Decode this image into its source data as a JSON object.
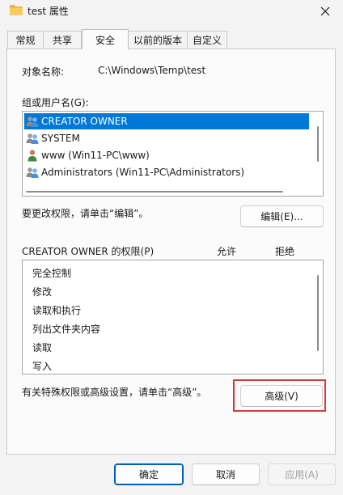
{
  "window": {
    "title": "test 属性",
    "close_glyph": "✕"
  },
  "tabs": [
    {
      "label": "常规",
      "active": false
    },
    {
      "label": "共享",
      "active": false
    },
    {
      "label": "安全",
      "active": true
    },
    {
      "label": "以前的版本",
      "active": false
    },
    {
      "label": "自定义",
      "active": false
    }
  ],
  "object": {
    "label": "对象名称:",
    "value": "C:\\Windows\\Temp\\test"
  },
  "groups": {
    "label": "组或用户名(G):",
    "items": [
      {
        "name": "CREATOR OWNER",
        "icon": "group-icon",
        "selected": true
      },
      {
        "name": "SYSTEM",
        "icon": "group-icon",
        "selected": false
      },
      {
        "name": "www (Win11-PC\\www)",
        "icon": "user-icon",
        "selected": false
      },
      {
        "name": "Administrators (Win11-PC\\Administrators)",
        "icon": "group-icon",
        "selected": false
      }
    ]
  },
  "edit": {
    "hint": "要更改权限，请单击“编辑”。",
    "button": "编辑(E)..."
  },
  "permissions": {
    "title": "CREATOR OWNER 的权限(P)",
    "allow_col": "允许",
    "deny_col": "拒绝",
    "items": [
      "完全控制",
      "修改",
      "读取和执行",
      "列出文件夹内容",
      "读取",
      "写入"
    ]
  },
  "advanced": {
    "hint": "有关特殊权限或高级设置，请单击“高级”。",
    "button": "高级(V)"
  },
  "footer": {
    "ok": "确定",
    "cancel": "取消",
    "apply": "应用(A)"
  },
  "colors": {
    "selection": "#0078d7",
    "accent_border": "#005fb8",
    "highlight": "#d93838"
  }
}
